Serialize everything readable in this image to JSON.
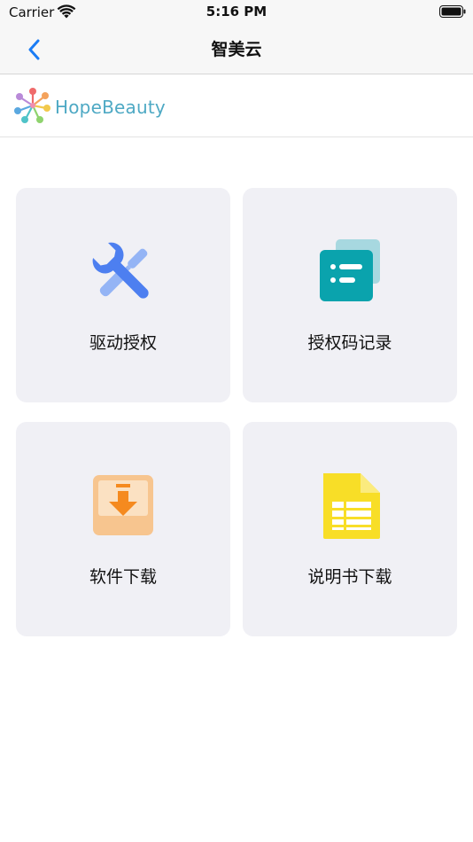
{
  "status_bar": {
    "carrier": "Carrier",
    "time": "5:16 PM",
    "wifi_icon": "wifi-icon",
    "battery_icon": "battery-icon"
  },
  "nav_bar": {
    "title": "智美云",
    "back_icon": "chevron-left-icon",
    "accent": "#1a7cf5"
  },
  "brand": {
    "logo_text": "HopeBeauty",
    "logo_icon": "hopebeauty-logo-icon",
    "text_color": "#4ea9c4"
  },
  "menu": {
    "items": [
      {
        "label": "驱动授权",
        "icon": "wrench-screwdriver-icon"
      },
      {
        "label": "授权码记录",
        "icon": "list-document-icon"
      },
      {
        "label": "软件下载",
        "icon": "download-tray-icon"
      },
      {
        "label": "说明书下载",
        "icon": "spreadsheet-document-icon"
      }
    ],
    "card_color": "#f0f0f5"
  }
}
